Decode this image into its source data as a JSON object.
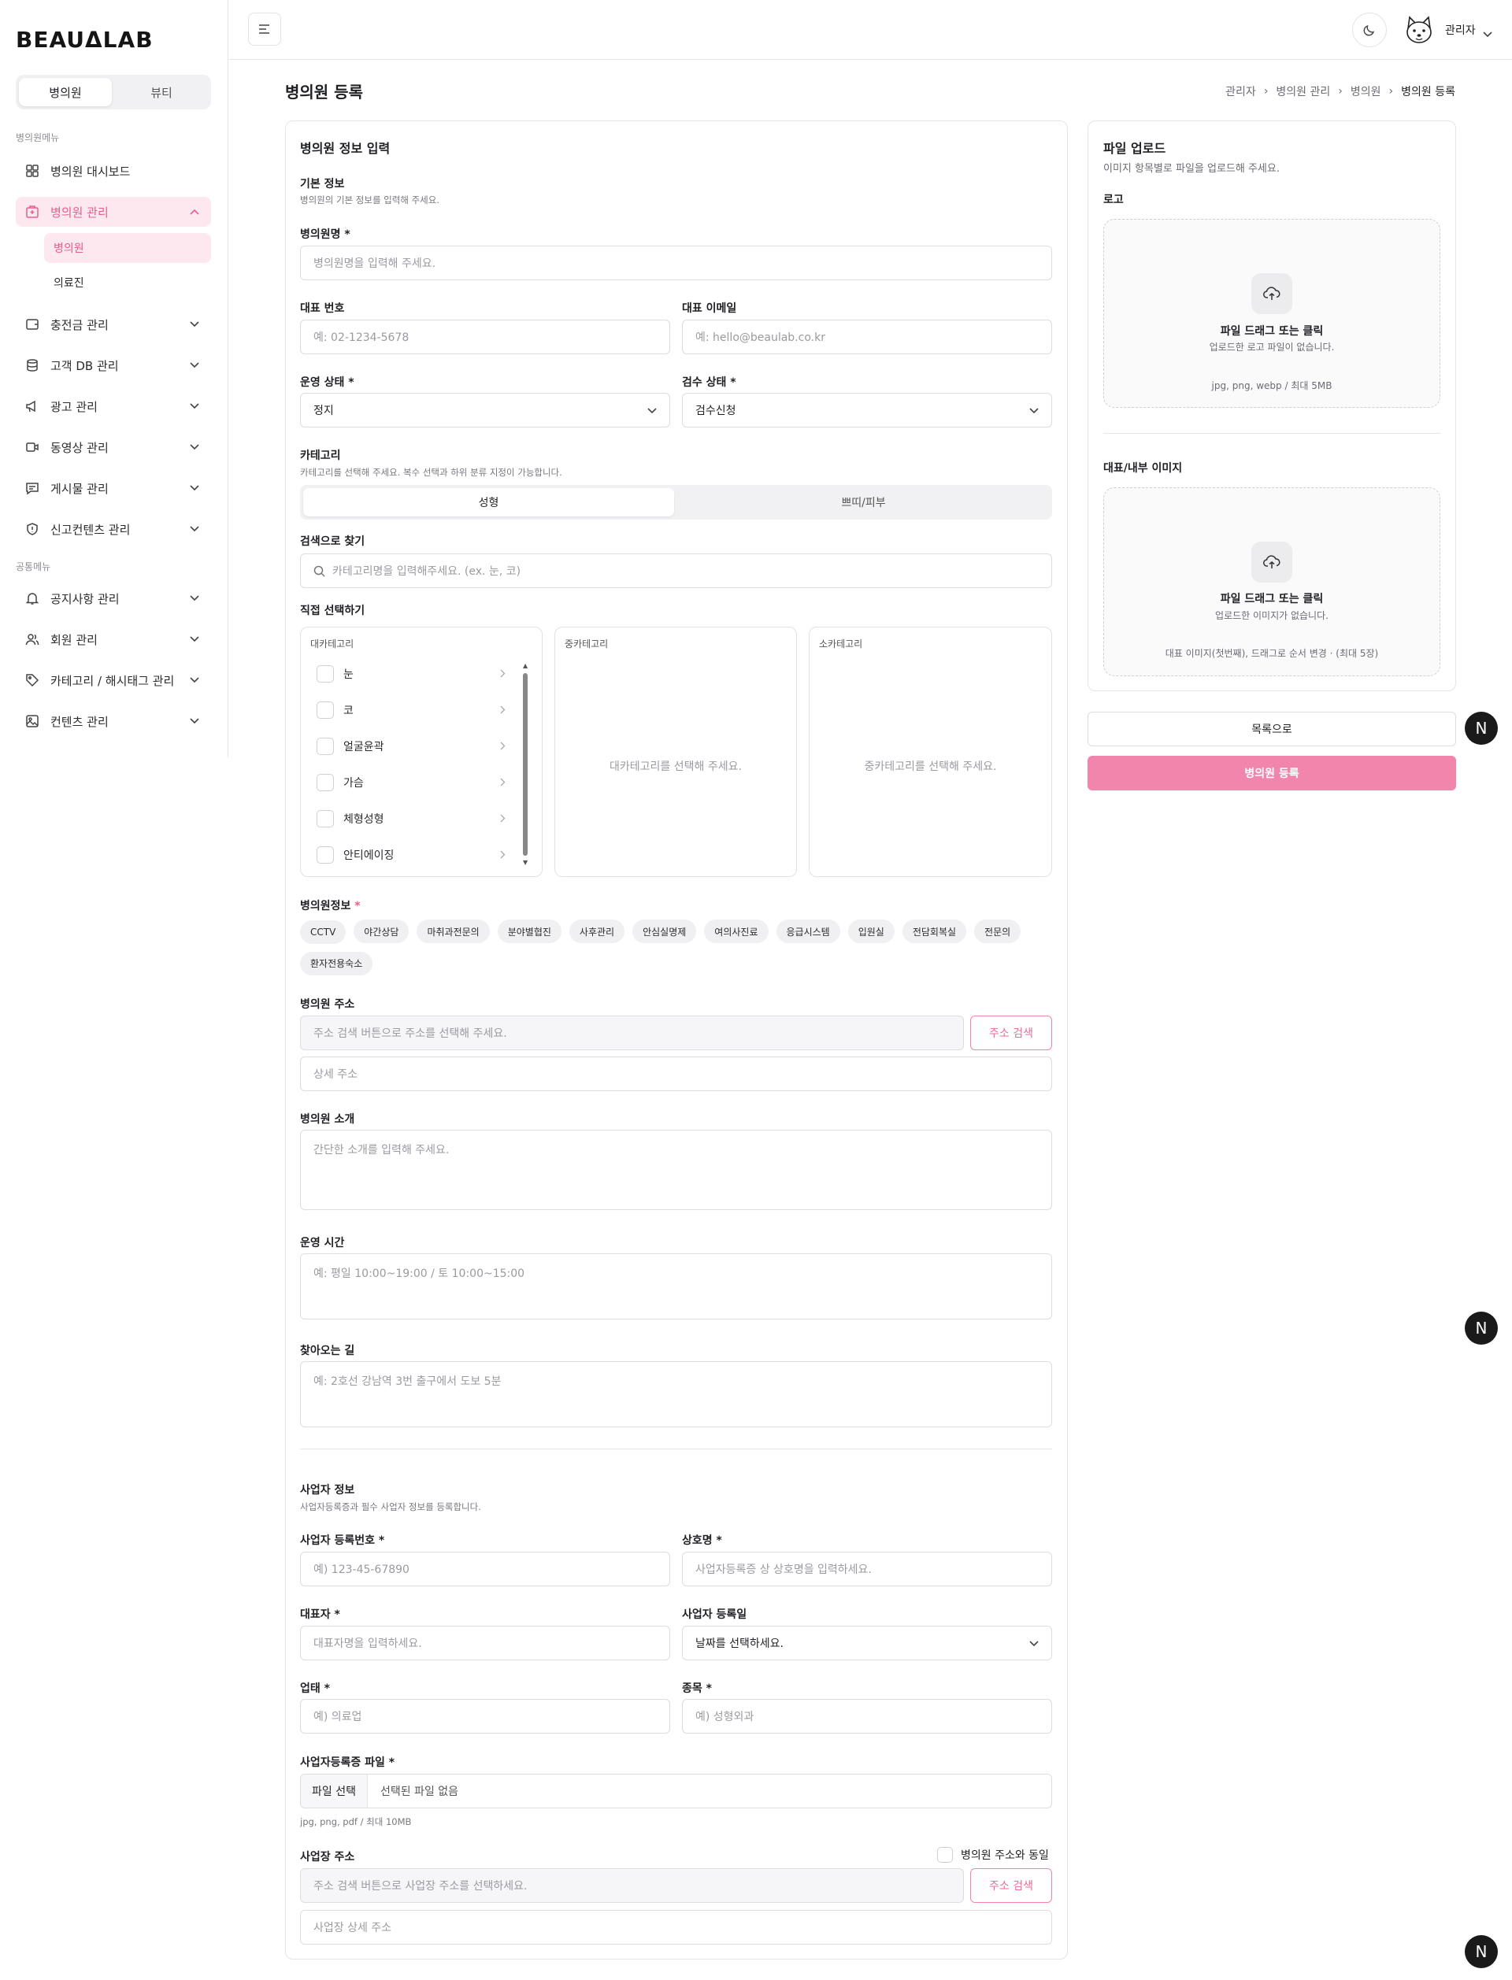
{
  "brand": {
    "logo": "BEAUᐃLAB"
  },
  "sidebar": {
    "segments": [
      "병의원",
      "뷰티"
    ],
    "section1": "병의원메뉴",
    "section2": "공통메뉴",
    "items": [
      {
        "label": "병의원 대시보드",
        "icon": "dashboard-grid-icon"
      },
      {
        "label": "병의원 관리",
        "icon": "hospital-icon"
      },
      {
        "label": "충전금 관리",
        "icon": "wallet-icon"
      },
      {
        "label": "고객 DB 관리",
        "icon": "database-icon"
      },
      {
        "label": "광고 관리",
        "icon": "megaphone-icon"
      },
      {
        "label": "동영상 관리",
        "icon": "video-icon"
      },
      {
        "label": "게시물 관리",
        "icon": "message-icon"
      },
      {
        "label": "신고컨텐츠 관리",
        "icon": "shield-alert-icon"
      },
      {
        "label": "공지사항 관리",
        "icon": "bell-icon"
      },
      {
        "label": "회원 관리",
        "icon": "users-icon"
      },
      {
        "label": "카테고리 / 해시태그 관리",
        "icon": "tag-icon"
      },
      {
        "label": "컨텐츠 관리",
        "icon": "image-icon"
      }
    ],
    "sub": [
      "병의원",
      "의료진"
    ]
  },
  "header": {
    "user": "관리자"
  },
  "page": {
    "title": "병의원 등록",
    "breadcrumb": [
      "관리자",
      "병의원 관리",
      "병의원",
      "병의원 등록"
    ]
  },
  "form": {
    "title": "병의원 정보 입력",
    "basic": {
      "title": "기본 정보",
      "desc": "병의원의 기본 정보를 입력해 주세요."
    },
    "name": {
      "label": "병의원명 *",
      "placeholder": "병의원명을 입력해 주세요."
    },
    "phone": {
      "label": "대표 번호",
      "placeholder": "예: 02-1234-5678"
    },
    "email": {
      "label": "대표 이메일",
      "placeholder": "예: hello@beaulab.co.kr"
    },
    "op_status": {
      "label": "운영 상태 *",
      "value": "정지"
    },
    "review_status": {
      "label": "검수 상태 *",
      "value": "검수신청"
    },
    "category": {
      "label": "카테고리",
      "desc": "카테고리를 선택해 주세요. 복수 선택과 하위 분류 지정이 가능합니다.",
      "tabs": [
        "성형",
        "쁘띠/피부"
      ]
    },
    "search": {
      "label": "검색으로 찾기",
      "placeholder": "카테고리명을 입력해주세요. (ex. 눈, 코)"
    },
    "direct": {
      "label": "직접 선택하기"
    },
    "cat_cols": [
      {
        "head": "대카테고리",
        "items": [
          "눈",
          "코",
          "얼굴윤곽",
          "가슴",
          "체형성형",
          "안티에이징"
        ]
      },
      {
        "head": "중카테고리",
        "empty": "대카테고리를 선택해 주세요."
      },
      {
        "head": "소카테고리",
        "empty": "중카테고리를 선택해 주세요."
      }
    ],
    "info": {
      "label": "병의원정보",
      "required": "*",
      "chips": [
        "CCTV",
        "야간상담",
        "마취과전문의",
        "분야별협진",
        "사후관리",
        "안심실명제",
        "여의사진료",
        "응급시스템",
        "입원실",
        "전담회복실",
        "전문의",
        "환자전용숙소"
      ]
    },
    "address": {
      "label": "병의원 주소",
      "placeholder": "주소 검색 버튼으로 주소를 선택해 주세요.",
      "button": "주소 검색",
      "detail": "상세 주소"
    },
    "intro": {
      "label": "병의원 소개",
      "placeholder": "간단한 소개를 입력해 주세요."
    },
    "hours": {
      "label": "운영 시간",
      "placeholder": "예: 평일 10:00~19:00 / 토 10:00~15:00"
    },
    "directions": {
      "label": "찾아오는 길",
      "placeholder": "예: 2호선 강남역 3번 출구에서 도보 5분"
    },
    "biz": {
      "title": "사업자 정보",
      "desc": "사업자등록증과 필수 사업자 정보를 등록합니다."
    },
    "biz_no": {
      "label": "사업자 등록번호 *",
      "placeholder": "예) 123-45-67890"
    },
    "biz_name": {
      "label": "상호명 *",
      "placeholder": "사업자등록증 상 상호명을 입력하세요."
    },
    "ceo": {
      "label": "대표자 *",
      "placeholder": "대표자명을 입력하세요."
    },
    "biz_date": {
      "label": "사업자 등록일",
      "value": "날짜를 선택하세요."
    },
    "biz_type": {
      "label": "업태 *",
      "placeholder": "예) 의료업"
    },
    "biz_item": {
      "label": "종목 *",
      "placeholder": "예) 성형외과"
    },
    "biz_file": {
      "label": "사업자등록증 파일 *",
      "button": "파일 선택",
      "value": "선택된 파일 없음",
      "hint": "jpg, png, pdf / 최대 10MB"
    },
    "biz_addr": {
      "label": "사업장 주소",
      "same": "병의원 주소와 동일",
      "placeholder": "주소 검색 버튼으로 사업장 주소를 선택하세요.",
      "button": "주소 검색",
      "detail": "사업장 상세 주소"
    }
  },
  "upload": {
    "title": "파일 업로드",
    "desc": "이미지 항목별로 파일을 업로드해 주세요.",
    "logo": {
      "label": "로고",
      "t1": "파일 드래그 또는 클릭",
      "t2": "업로드한 로고 파일이 없습니다.",
      "t3": "jpg, png, webp / 최대 5MB"
    },
    "images": {
      "label": "대표/내부 이미지",
      "t1": "파일 드래그 또는 클릭",
      "t2": "업로드한 이미지가 없습니다.",
      "t3": "대표 이미지(첫번째), 드래그로 순서 변경 · (최대 5장)"
    }
  },
  "actions": {
    "list": "목록으로",
    "submit": "병의원 등록"
  },
  "badge": "N",
  "colors": {
    "accent": "#f285ab",
    "accent_text": "#e85d8a",
    "active_bg": "#fde8ef"
  }
}
